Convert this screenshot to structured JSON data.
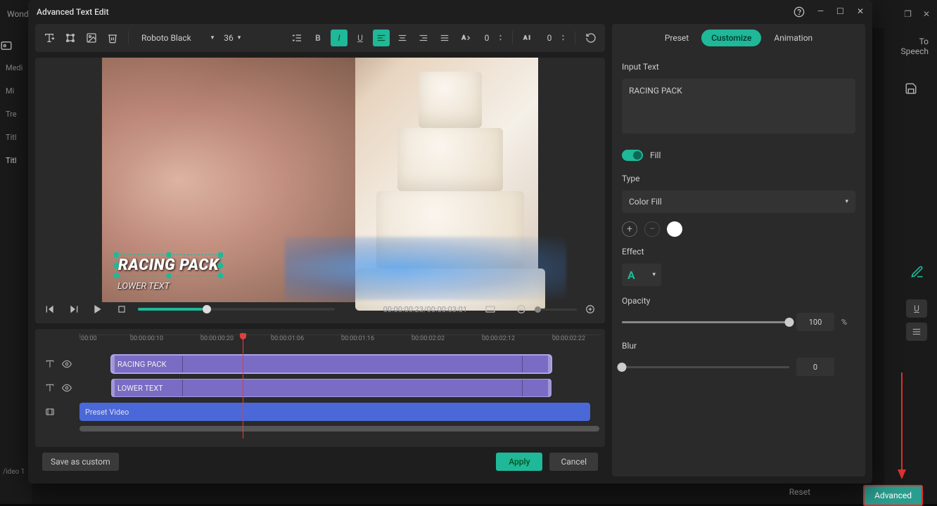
{
  "bg": {
    "title": "Wonde",
    "mediaTab": "Medi",
    "sidebar": [
      "Mi",
      "Tre",
      "Titl",
      "Titl"
    ],
    "rightTop": "To Speech",
    "reset": "Reset",
    "advanced": "Advanced",
    "video1": "/ideo 1"
  },
  "modal": {
    "title": "Advanced Text Edit"
  },
  "toolbar": {
    "font": "Roboto Black",
    "size": "36",
    "lineHeight": "0",
    "letterSpacing": "0"
  },
  "preview": {
    "racingText": "RACING PACK",
    "lowerText": "LOWER TEXT"
  },
  "playback": {
    "time": "00:00:00:23/00:00:03:01"
  },
  "ruler": {
    "ticks": [
      ":00:00",
      "00:00:00:10",
      "00:00:00:20",
      "00:00:01:06",
      "00:00:01:16",
      "00:00:02:02",
      "00:00:02:12",
      "00:00:02:22"
    ]
  },
  "tracks": {
    "clip1": "RACING PACK",
    "clip2": "LOWER TEXT",
    "clip3": "Preset Video"
  },
  "footer": {
    "saveCustom": "Save as custom",
    "apply": "Apply",
    "cancel": "Cancel"
  },
  "panel": {
    "tabs": {
      "preset": "Preset",
      "customize": "Customize",
      "animation": "Animation"
    },
    "inputTextLabel": "Input Text",
    "inputTextValue": "RACING PACK",
    "fillLabel": "Fill",
    "typeLabel": "Type",
    "typeValue": "Color Fill",
    "effectLabel": "Effect",
    "opacityLabel": "Opacity",
    "opacityValue": "100",
    "opacityUnit": "%",
    "blurLabel": "Blur",
    "blurValue": "0"
  }
}
